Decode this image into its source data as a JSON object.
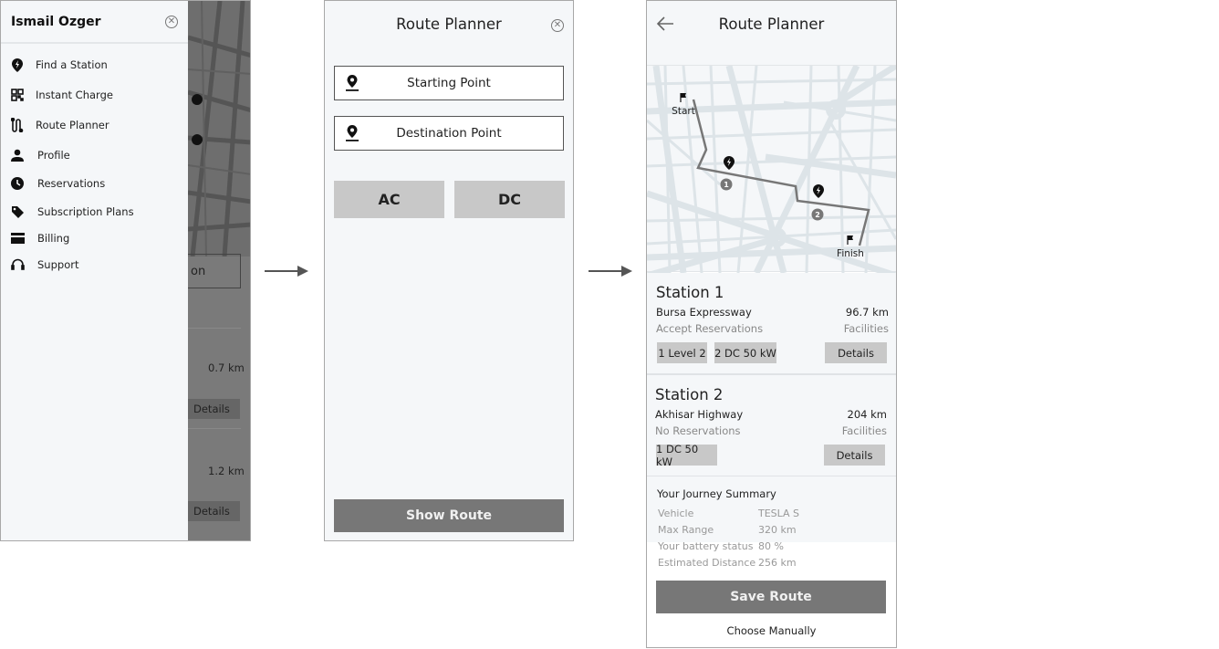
{
  "menu_screen": {
    "user_name": "Ismail Ozger",
    "items": [
      {
        "label": "Find a Station",
        "icon": "charging-pin-icon"
      },
      {
        "label": "Instant Charge",
        "icon": "qr-code-icon"
      },
      {
        "label": "Route Planner",
        "icon": "route-icon"
      },
      {
        "label": "Profile",
        "icon": "person-icon"
      },
      {
        "label": "Reservations",
        "icon": "clock-icon"
      },
      {
        "label": "Subscription Plans",
        "icon": "tag-icon"
      },
      {
        "label": "Billing",
        "icon": "card-icon"
      },
      {
        "label": "Support",
        "icon": "headset-icon"
      }
    ],
    "background": {
      "button_fragment": "on",
      "distance1": "0.7 km",
      "distance2": "1.2 km",
      "details": "Details"
    }
  },
  "planner_screen": {
    "title": "Route Planner",
    "starting_point": "Starting Point",
    "destination_point": "Destination Point",
    "ac": "AC",
    "dc": "DC",
    "show_route": "Show Route"
  },
  "result_screen": {
    "title": "Route Planner",
    "map": {
      "start": "Start",
      "finish": "Finish",
      "stop1": "1",
      "stop2": "2"
    },
    "stations": [
      {
        "title": "Station 1",
        "road": "Bursa Expressway",
        "distance": "96.7 km",
        "reservation": "Accept Reservations",
        "facilities": "Facilities",
        "chips": [
          "1 Level 2",
          "2 DC 50 kW"
        ],
        "details": "Details"
      },
      {
        "title": "Station 2",
        "road": "Akhisar Highway",
        "distance": "204 km",
        "reservation": "No Reservations",
        "facilities": "Facilities",
        "chips": [
          "1 DC 50 kW"
        ],
        "details": "Details"
      }
    ],
    "summary": {
      "heading": "Your Journey Summary",
      "rows": [
        {
          "label": "Vehicle",
          "value": "TESLA S"
        },
        {
          "label": "Max Range",
          "value": "320 km"
        },
        {
          "label": "Your battery status",
          "value": "80 %"
        },
        {
          "label": "Estimated Distance",
          "value": "256 km"
        }
      ]
    },
    "save_route": "Save Route",
    "choose_manually": "Choose Manually"
  },
  "colors": {
    "primary_button": "#777777",
    "chip": "#c8c8c8",
    "panel": "#f5f7f9",
    "map_road": "#dde4e8"
  }
}
